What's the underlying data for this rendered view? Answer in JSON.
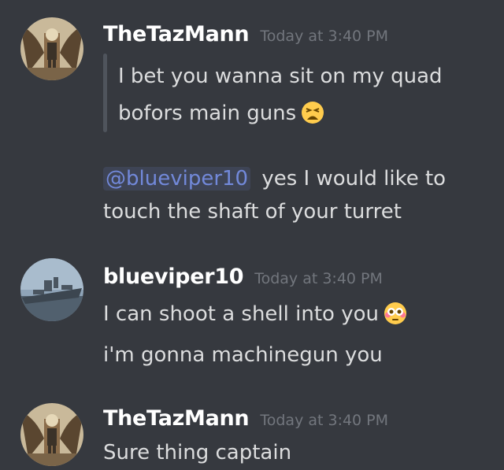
{
  "messages": [
    {
      "author": "TheTazMann",
      "timestamp": "Today at 3:40 PM",
      "quote_lines": [
        "I bet you wanna sit on my quad",
        "bofors main guns"
      ],
      "quote_emoji": "tired-face-emoji",
      "mention": "@blueviper10",
      "reply_lines": [
        "yes I would like to",
        "touch the shaft of your turret"
      ]
    },
    {
      "author": "blueviper10",
      "timestamp": "Today at 3:40 PM",
      "lines": [
        "I can shoot a shell into you",
        "i'm gonna machinegun you"
      ],
      "line1_emoji": "flushed-face-emoji"
    },
    {
      "author": "TheTazMann",
      "timestamp": "Today at 3:40 PM",
      "lines": [
        "Sure thing captain"
      ]
    }
  ],
  "colors": {
    "background": "#36393f",
    "username": "#ffffff",
    "timestamp": "#72767d",
    "text": "#dcddde",
    "mention": "#7289da",
    "quote_bar": "#4f545c"
  }
}
